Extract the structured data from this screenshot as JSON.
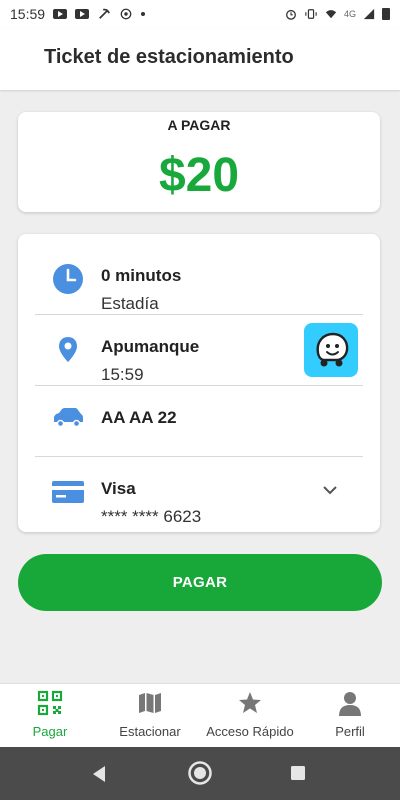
{
  "status_bar": {
    "time": "15:59",
    "network": "4G"
  },
  "header": {
    "title": "Ticket de estacionamiento"
  },
  "amount": {
    "label": "A PAGAR",
    "value": "$20"
  },
  "details": {
    "duration": {
      "title": "0 minutos",
      "subtitle": "Estadía",
      "icon": "clock-icon"
    },
    "location": {
      "title": "Apumanque",
      "subtitle": "15:59",
      "icon": "location-pin-icon"
    },
    "vehicle": {
      "title": "AA AA 22",
      "icon": "car-icon"
    },
    "payment": {
      "title": "Visa",
      "subtitle": "**** **** 6623",
      "icon": "credit-card-icon"
    }
  },
  "pay_button": {
    "label": "PAGAR"
  },
  "bottom_nav": {
    "items": [
      {
        "label": "Pagar",
        "icon": "qr-code-icon",
        "active": true
      },
      {
        "label": "Estacionar",
        "icon": "map-icon",
        "active": false
      },
      {
        "label": "Acceso Rápido",
        "icon": "star-icon",
        "active": false
      },
      {
        "label": "Perfil",
        "icon": "person-icon",
        "active": false
      }
    ]
  },
  "colors": {
    "accent": "#19a83b",
    "icon_blue": "#4a8fe0",
    "waze": "#33ccff"
  }
}
